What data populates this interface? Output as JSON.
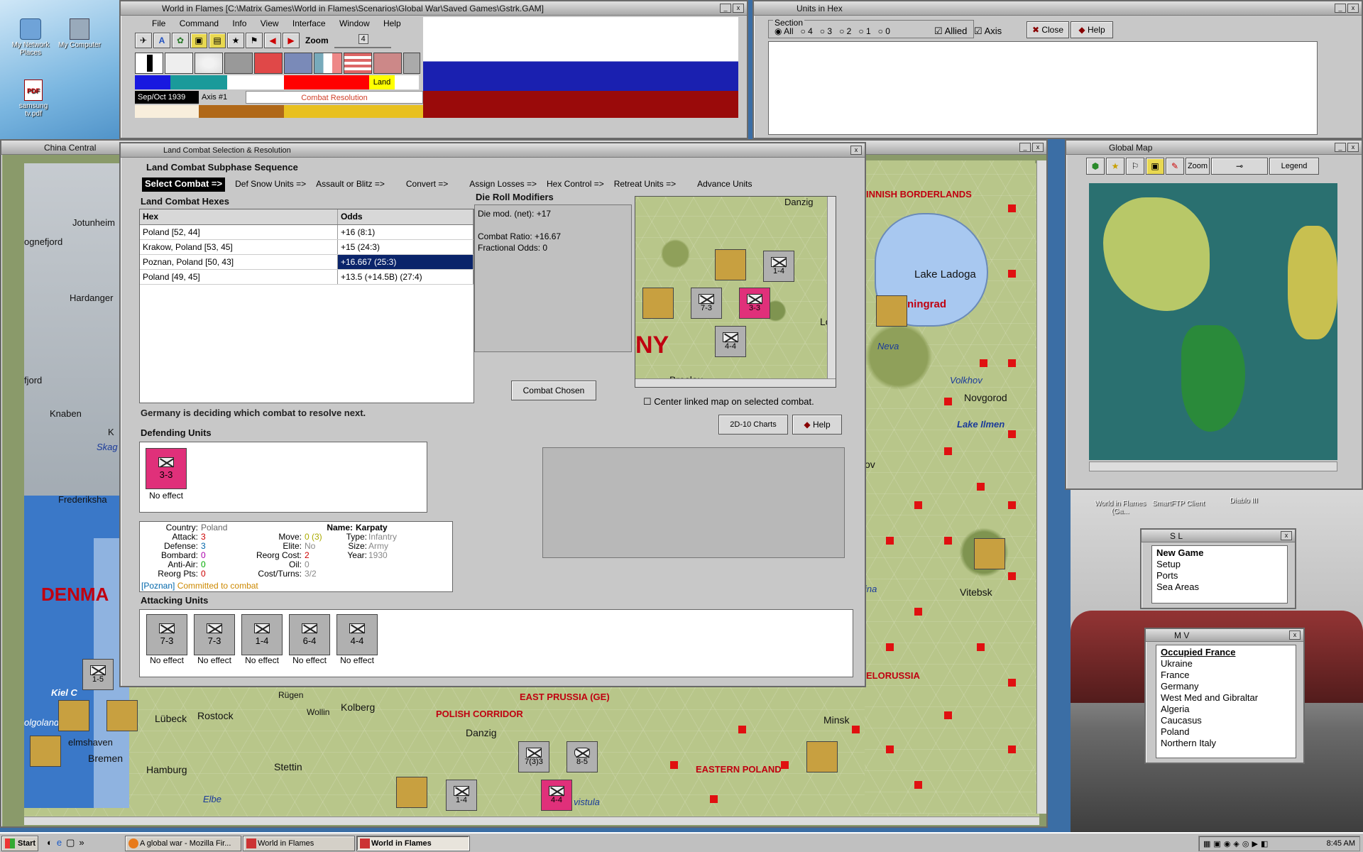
{
  "desktop": {
    "icons": [
      {
        "label": "My Network Places"
      },
      {
        "label": "My Computer"
      },
      {
        "label": "samsung tv.pdf"
      }
    ],
    "shortcuts": [
      {
        "label": "World in Flames (Ga..."
      },
      {
        "label": "SmartFTP Client"
      },
      {
        "label": "Diablo III"
      }
    ]
  },
  "main_window": {
    "title": "World in Flames [C:\\Matrix Games\\World in Flames\\Scenarios\\Global War\\Saved Games\\Gstrk.GAM]",
    "menu": [
      "File",
      "Command",
      "Info",
      "View",
      "Interface",
      "Window",
      "Help"
    ],
    "zoom_label": "Zoom",
    "zoom_value": "4",
    "date": "Sep/Oct 1939",
    "turn_side": "Axis #1",
    "phase": "Combat Resolution",
    "land_label": "Land"
  },
  "units_in_hex": {
    "title": "Units in Hex",
    "section_label": "Section",
    "section_options": [
      "All",
      "4",
      "3",
      "2",
      "1",
      "0"
    ],
    "allied_label": "Allied",
    "axis_label": "Axis",
    "close_label": "Close",
    "help_label": "Help"
  },
  "china_central": {
    "title": "China Central",
    "labels": [
      "Jotunheim",
      "ognefjord",
      "Hardanger",
      "fjord",
      "Knaben",
      "K",
      "Skag",
      "Frederiksha",
      "DENMA",
      "Kiel C",
      "olgoland",
      "elmshaven",
      "Bremen",
      "Hamburg",
      "Elbe",
      "Stettin",
      "Lübeck",
      "Rostock",
      "Wollin",
      "Rügen",
      "Kolberg"
    ]
  },
  "global_map": {
    "title": "Global Map",
    "zoom_label": "Zoom",
    "legend_label": "Legend"
  },
  "sl_window": {
    "title": "S L",
    "items": [
      "New Game",
      "Setup",
      "Ports",
      "Sea Areas"
    ]
  },
  "mv_window": {
    "title": "M V",
    "items": [
      "Occupied France",
      "Ukraine",
      "France",
      "Germany",
      "West Med and Gibraltar",
      "Algeria",
      "Caucasus",
      "Poland",
      "Northern Italy"
    ]
  },
  "right_map": {
    "labels": [
      "INNISH BORDERLANDS",
      "Lake Ladoga",
      "ningrad",
      "Neva",
      "Volkhov",
      "Novgorod",
      "Lake Ilmen",
      "ov",
      "Vitebsk",
      "ina",
      "Minsk",
      "ELORUSSIA",
      "EASTERN POLAND",
      "vistula",
      "POLISH CORRIDOR",
      "EAST PRUSSIA (GE)",
      "Danzig"
    ]
  },
  "combat_dialog": {
    "title": "Land Combat Selection & Resolution",
    "sequence_label": "Land Combat Subphase Sequence",
    "sequence": [
      "Select Combat =>",
      "Def Snow Units =>",
      "Assault or Blitz =>",
      "Convert =>",
      "Assign Losses =>",
      "Hex Control =>",
      "Retreat Units =>",
      "Advance Units"
    ],
    "hexes_label": "Land Combat Hexes",
    "hex_col": "Hex",
    "odds_col": "Odds",
    "hexes": [
      {
        "hex": "Poland [52, 44]",
        "odds": "+16 (8:1)"
      },
      {
        "hex": "Krakow, Poland [53, 45]",
        "odds": "+15 (24:3)"
      },
      {
        "hex": "Poznan, Poland [50, 43]",
        "odds": "+16.667 (25:3)"
      },
      {
        "hex": "Poland [49, 45]",
        "odds": "+13.5 (+14.5B) (27:4)"
      }
    ],
    "die_roll_label": "Die Roll Modifiers",
    "die_mod": "Die mod. (net): +17",
    "combat_ratio": "Combat Ratio: +16.67",
    "fractional_odds": "Fractional Odds: 0",
    "combat_chosen_label": "Combat Chosen",
    "center_map_label": "Center linked map on selected combat.",
    "charts_label": "2D-10 Charts",
    "help_label": "Help",
    "status": "Germany is deciding which combat to resolve next.",
    "defending_label": "Defending Units",
    "defenders": [
      {
        "strength": "3-3",
        "result": "No effect"
      }
    ],
    "info": {
      "country_k": "Country:",
      "country_v": "Poland",
      "attack_k": "Attack:",
      "attack_v": "3",
      "defense_k": "Defense:",
      "defense_v": "3",
      "bombard_k": "Bombard:",
      "bombard_v": "0",
      "antiair_k": "Anti-Air:",
      "antiair_v": "0",
      "reorg_k": "Reorg Pts:",
      "reorg_v": "0",
      "move_k": "Move:",
      "move_v": "0 (3)",
      "elite_k": "Elite:",
      "elite_v": "No",
      "reorgcost_k": "Reorg Cost:",
      "reorgcost_v": "2",
      "oil_k": "Oil:",
      "oil_v": "0",
      "cost_k": "Cost/Turns:",
      "cost_v": "3/2",
      "name_k": "Name:",
      "name_v": "Karpaty",
      "type_k": "Type:",
      "type_v": "Infantry",
      "size_k": "Size:",
      "size_v": "Army",
      "year_k": "Year:",
      "year_v": "1930",
      "footer_loc": "[Poznan]",
      "footer_status": "Committed to combat"
    },
    "attacking_label": "Attacking Units",
    "attackers": [
      {
        "strength": "7-3",
        "result": "No effect"
      },
      {
        "strength": "7-3",
        "result": "No effect"
      },
      {
        "strength": "1-4",
        "result": "No effect"
      },
      {
        "strength": "6-4",
        "result": "No effect"
      },
      {
        "strength": "4-4",
        "result": "No effect"
      }
    ],
    "minimap_labels": [
      "NY",
      "Breslau",
      "Lo",
      "Danzig"
    ],
    "minimap_counters": [
      "7-3",
      "3-3",
      "4-4",
      "1-4"
    ]
  },
  "bottom_map_counters": [
    "1-5",
    "7(3)3",
    "8-5",
    "1-4",
    "4-4"
  ],
  "taskbar": {
    "start_label": "Start",
    "tasks": [
      "A global war - Mozilla Fir...",
      "World in Flames",
      "World in Flames"
    ],
    "clock": "8:45 AM"
  },
  "colors": {
    "selection": "#0a246a",
    "defender_pink": "#e0307a",
    "map_red": "#e01010"
  }
}
